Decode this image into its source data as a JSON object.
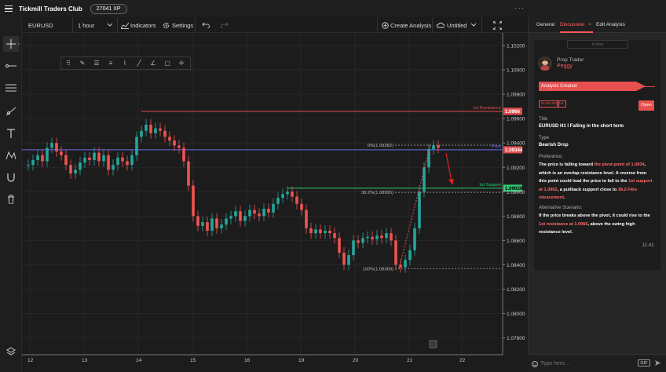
{
  "app": {
    "club_name": "Tickmill Traders Club",
    "xp": "27041 XP",
    "menu_dots": "···"
  },
  "toolbar": {
    "symbol": "EURUSD",
    "timeframe": "1 hour",
    "indicators_label": "Indicators",
    "settings_label": "Settings",
    "create_analysis_label": "Create Analysis",
    "untitled_label": "Untitled"
  },
  "panel": {
    "tabs": [
      {
        "label": "General"
      },
      {
        "label": "Discussion"
      },
      {
        "label": "Edit Analysis"
      }
    ],
    "follow_label": "Follow",
    "author_role": "Prop Trader",
    "author_name": "Peggy",
    "analysis_created": "Analysis Created",
    "badges": [
      "EURUSD",
      "H1"
    ],
    "open_label": "Open",
    "title_label": "Title",
    "title_value": "EURUSD H1 I Falling in the short term",
    "type_label": "Type",
    "type_value": "Bearish Drop",
    "preference_label": "Preference:",
    "preference": {
      "p1": "The price is falling toward ",
      "p2": "the pivot point of 1.0934",
      "p3": ", which is an overlap resistance level. A reverse from this point could lead the price to fall to the ",
      "p4": "1st support at 1.0902",
      "p5": ", a pullback support close to ",
      "p6": "38.2 Fibo retracement",
      "p7": "."
    },
    "alt_label": "Alternative Scenario:",
    "alternative": {
      "a1": "If the price breaks above the pivot, it could rise to the ",
      "a2": "1st resistance at 1.0966",
      "a3": ", above the swing high resistance level."
    },
    "time": "11:41",
    "input_placeholder": "Type here...",
    "gif_label": "GIF"
  },
  "chart": {
    "price_labels": [
      "1.10200",
      "1.10000",
      "1.09800",
      "1.09600",
      "1.09400",
      "1.09200",
      "1.09000",
      "1.08800",
      "1.08600",
      "1.08400",
      "1.08200",
      "1.08000",
      "1.07800"
    ],
    "date_labels": [
      "12",
      "13",
      "14",
      "15",
      "16",
      "19",
      "20",
      "21",
      "22"
    ],
    "line_labels": {
      "resistance": "1st Resistance",
      "pivot": "Pivot",
      "support": "1st Support"
    },
    "price_tags": {
      "resistance": "1.0966",
      "pivot": "1.09344",
      "support": "1.09029"
    },
    "fib_labels": {
      "f0": "0%(1.09382)",
      "f382": "38.2%(1.08995)",
      "f100": "100%(1.08369)"
    },
    "colors": {
      "up": "#26a69a",
      "down": "#ef5350",
      "resistance": "#e84d4d",
      "pivot": "#6a6af0",
      "support": "#2ecc71"
    }
  }
}
